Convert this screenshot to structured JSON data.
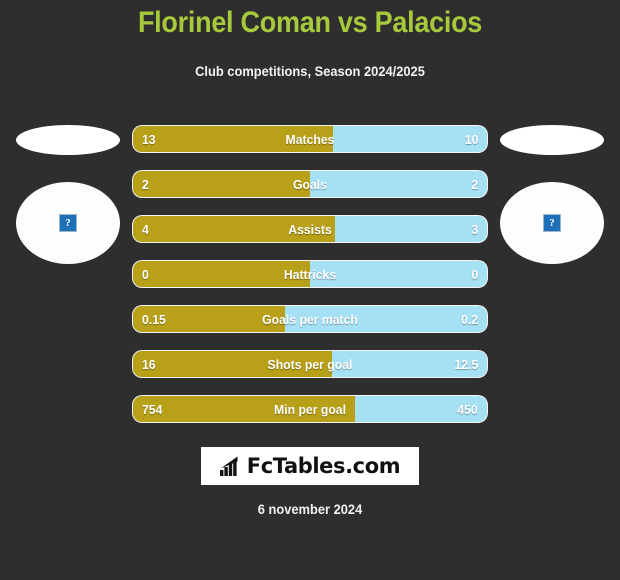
{
  "header": {
    "title": "Florinel Coman vs Palacios",
    "subtitle": "Club competitions, Season 2024/2025",
    "title_color": "#a7c93c"
  },
  "teams": {
    "home": {
      "flag_alt": "?",
      "crest_alt": "?"
    },
    "away": {
      "flag_alt": "?",
      "crest_alt": "?"
    }
  },
  "colors": {
    "home_bar": "#b8a018",
    "away_bar": "#a5e0f5",
    "background": "#2e2e2e",
    "title": "#a7c93c"
  },
  "chart_data": {
    "type": "bar",
    "title": "Florinel Coman vs Palacios",
    "subtitle": "Club competitions, Season 2024/2025",
    "orientation": "horizontal-diverging",
    "series": [
      {
        "name": "Florinel Coman",
        "color": "#b8a018",
        "values": [
          13,
          2,
          4,
          0,
          0.15,
          16,
          754
        ]
      },
      {
        "name": "Palacios",
        "color": "#a5e0f5",
        "values": [
          10,
          2,
          3,
          0,
          0.2,
          12.5,
          450
        ]
      }
    ],
    "categories": [
      "Matches",
      "Goals",
      "Assists",
      "Hattricks",
      "Goals per match",
      "Shots per goal",
      "Min per goal"
    ],
    "rows": [
      {
        "label": "Matches",
        "home": "13",
        "away": "10",
        "home_pct": 56.5
      },
      {
        "label": "Goals",
        "home": "2",
        "away": "2",
        "home_pct": 50.0
      },
      {
        "label": "Assists",
        "home": "4",
        "away": "3",
        "home_pct": 57.1
      },
      {
        "label": "Hattricks",
        "home": "0",
        "away": "0",
        "home_pct": 50.0
      },
      {
        "label": "Goals per match",
        "home": "0.15",
        "away": "0.2",
        "home_pct": 42.9
      },
      {
        "label": "Shots per goal",
        "home": "16",
        "away": "12.5",
        "home_pct": 56.1
      },
      {
        "label": "Min per goal",
        "home": "754",
        "away": "450",
        "home_pct": 62.6
      }
    ],
    "grid": false,
    "legend": "none"
  },
  "footer": {
    "logo_text": "FcTables.com",
    "logo_icon": "bar-chart-icon",
    "date": "6 november 2024"
  }
}
